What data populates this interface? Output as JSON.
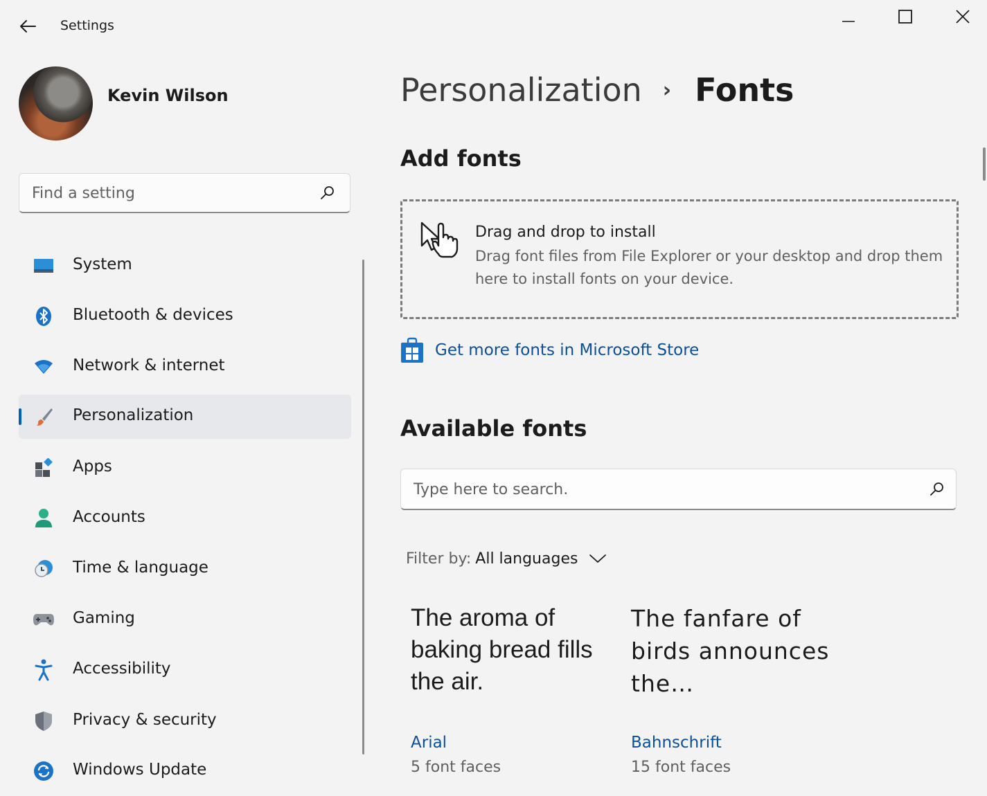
{
  "titlebar": {
    "title": "Settings"
  },
  "user": {
    "name": "Kevin Wilson"
  },
  "search": {
    "placeholder": "Find a setting"
  },
  "sidebar": {
    "items": [
      {
        "label": "System",
        "icon": "system-icon"
      },
      {
        "label": "Bluetooth & devices",
        "icon": "bluetooth-icon"
      },
      {
        "label": "Network & internet",
        "icon": "wifi-icon"
      },
      {
        "label": "Personalization",
        "icon": "paintbrush-icon",
        "active": true
      },
      {
        "label": "Apps",
        "icon": "apps-icon"
      },
      {
        "label": "Accounts",
        "icon": "person-icon"
      },
      {
        "label": "Time & language",
        "icon": "clock-globe-icon"
      },
      {
        "label": "Gaming",
        "icon": "gamepad-icon"
      },
      {
        "label": "Accessibility",
        "icon": "accessibility-icon"
      },
      {
        "label": "Privacy & security",
        "icon": "shield-icon"
      },
      {
        "label": "Windows Update",
        "icon": "update-icon"
      }
    ]
  },
  "breadcrumb": {
    "parent": "Personalization",
    "separator": "›",
    "current": "Fonts"
  },
  "add_fonts": {
    "title": "Add fonts",
    "dropzone_title": "Drag and drop to install",
    "dropzone_desc": "Drag font files from File Explorer or your desktop and drop them here to install fonts on your device.",
    "store_link": "Get more fonts in Microsoft Store"
  },
  "available_fonts": {
    "title": "Available fonts",
    "search_placeholder": "Type here to search.",
    "filter_label": "Filter by:",
    "filter_value": "All languages",
    "fonts": [
      {
        "preview": "The aroma of baking bread fills the air.",
        "name": "Arial",
        "faces": "5 font faces"
      },
      {
        "preview": "The fanfare of birds announces the…",
        "name": "Bahnschrift",
        "faces": "15 font faces"
      }
    ]
  },
  "colors": {
    "accent": "#005fb8",
    "link": "#0b4f99",
    "background": "#f3f3f3",
    "active_item": "#e6e8ec"
  }
}
